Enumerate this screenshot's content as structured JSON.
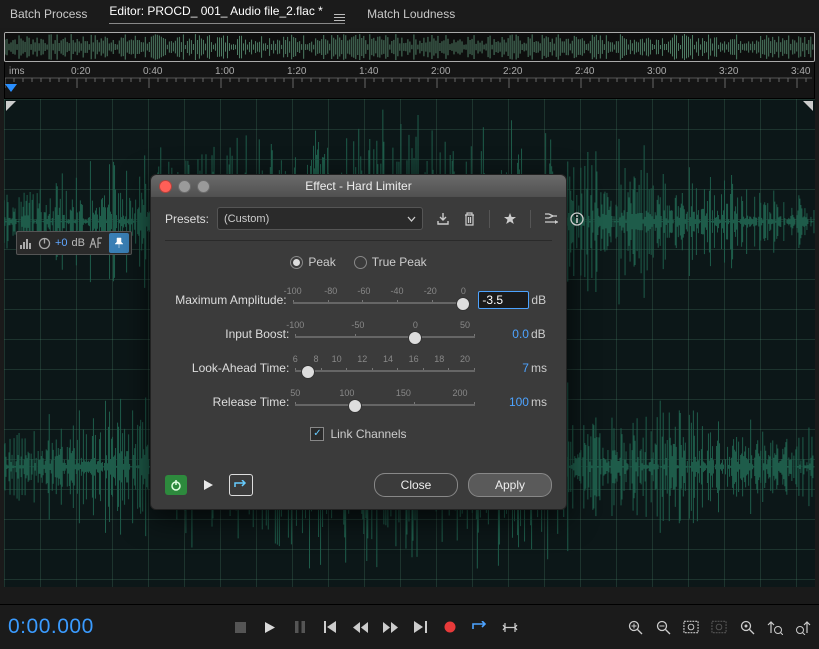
{
  "topbar": {
    "batch": "Batch Process",
    "editor": "Editor: PROCD_ 001_ Audio file_2.flac *",
    "match": "Match Loudness"
  },
  "timeline": {
    "labels": [
      "ims",
      "0:20",
      "0:40",
      "1:00",
      "1:20",
      "1:40",
      "2:00",
      "2:20",
      "2:40",
      "3:00",
      "3:20",
      "3:40"
    ]
  },
  "meter": {
    "val": "+0",
    "unit": "dB"
  },
  "dialog": {
    "title": "Effect - Hard Limiter",
    "presets_label": "Presets:",
    "preset_value": "(Custom)",
    "mode_peak": "Peak",
    "mode_truepeak": "True Peak",
    "params": {
      "max_amp": {
        "label": "Maximum Amplitude:",
        "ticks": [
          "-100",
          "-80",
          "-60",
          "-40",
          "-20",
          "0"
        ],
        "val": "-3.5",
        "unit": "dB",
        "handle": 0.97
      },
      "input_boost": {
        "label": "Input Boost:",
        "ticks": [
          "-100",
          "-50",
          "0",
          "50"
        ],
        "val": "0.0",
        "unit": "dB",
        "handle": 0.667
      },
      "lookahead": {
        "label": "Look-Ahead Time:",
        "ticks": [
          "6",
          "8",
          "10",
          "12",
          "14",
          "16",
          "18",
          "20"
        ],
        "val": "7",
        "unit": "ms",
        "handle": 0.071
      },
      "release": {
        "label": "Release Time:",
        "ticks": [
          "50",
          "100",
          "150",
          "200"
        ],
        "val": "100",
        "unit": "ms",
        "handle": 0.333
      }
    },
    "link_channels": "Link Channels",
    "close": "Close",
    "apply": "Apply"
  },
  "transport": {
    "timecode": "0:00.000"
  }
}
